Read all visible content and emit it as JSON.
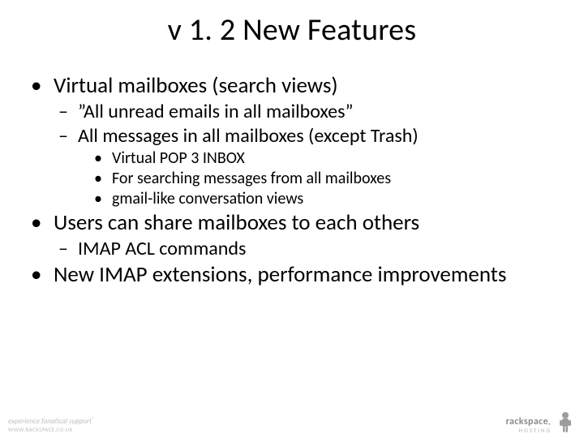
{
  "title": "v 1. 2 New Features",
  "bullets": {
    "b1": "Virtual mailboxes (search views)",
    "b1_1": "”All unread emails in all mailboxes”",
    "b1_2": "All messages in all mailboxes (except Trash)",
    "b1_2_1": "Virtual POP 3 INBOX",
    "b1_2_2": "For searching messages from all mailboxes",
    "b1_2_3": "gmail-like conversation views",
    "b2": "Users can share mailboxes to each others",
    "b2_1": "IMAP ACL commands",
    "b3": "New IMAP extensions, performance improvements"
  },
  "glyph": {
    "disc": "•",
    "dash": "–"
  },
  "footer": {
    "left_main": "experience fanatical support",
    "left_sub": "WWW.RACKSPACE.CO.UK",
    "right_brand": "rackspace",
    "right_sub": "HOSTING"
  }
}
